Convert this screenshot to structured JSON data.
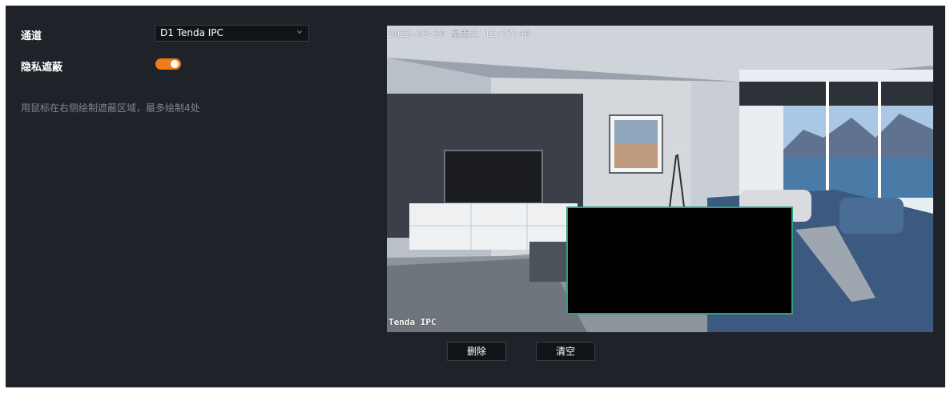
{
  "form": {
    "channel_label": "通道",
    "channel_value": "D1 Tenda IPC",
    "privacy_label": "隐私遮蔽",
    "privacy_enabled": true,
    "hint": "用鼠标在右侧绘制遮蔽区域，最多绘制4处"
  },
  "video": {
    "timestamp": "2022-03-30 星期三 11:17:46",
    "camera_name": "Tenda IPC"
  },
  "buttons": {
    "delete_label": "删除",
    "clear_label": "清空"
  },
  "colors": {
    "panel_bg": "#1f2229",
    "toggle_on": "#f07c18",
    "mask_border": "#2e9e86"
  }
}
